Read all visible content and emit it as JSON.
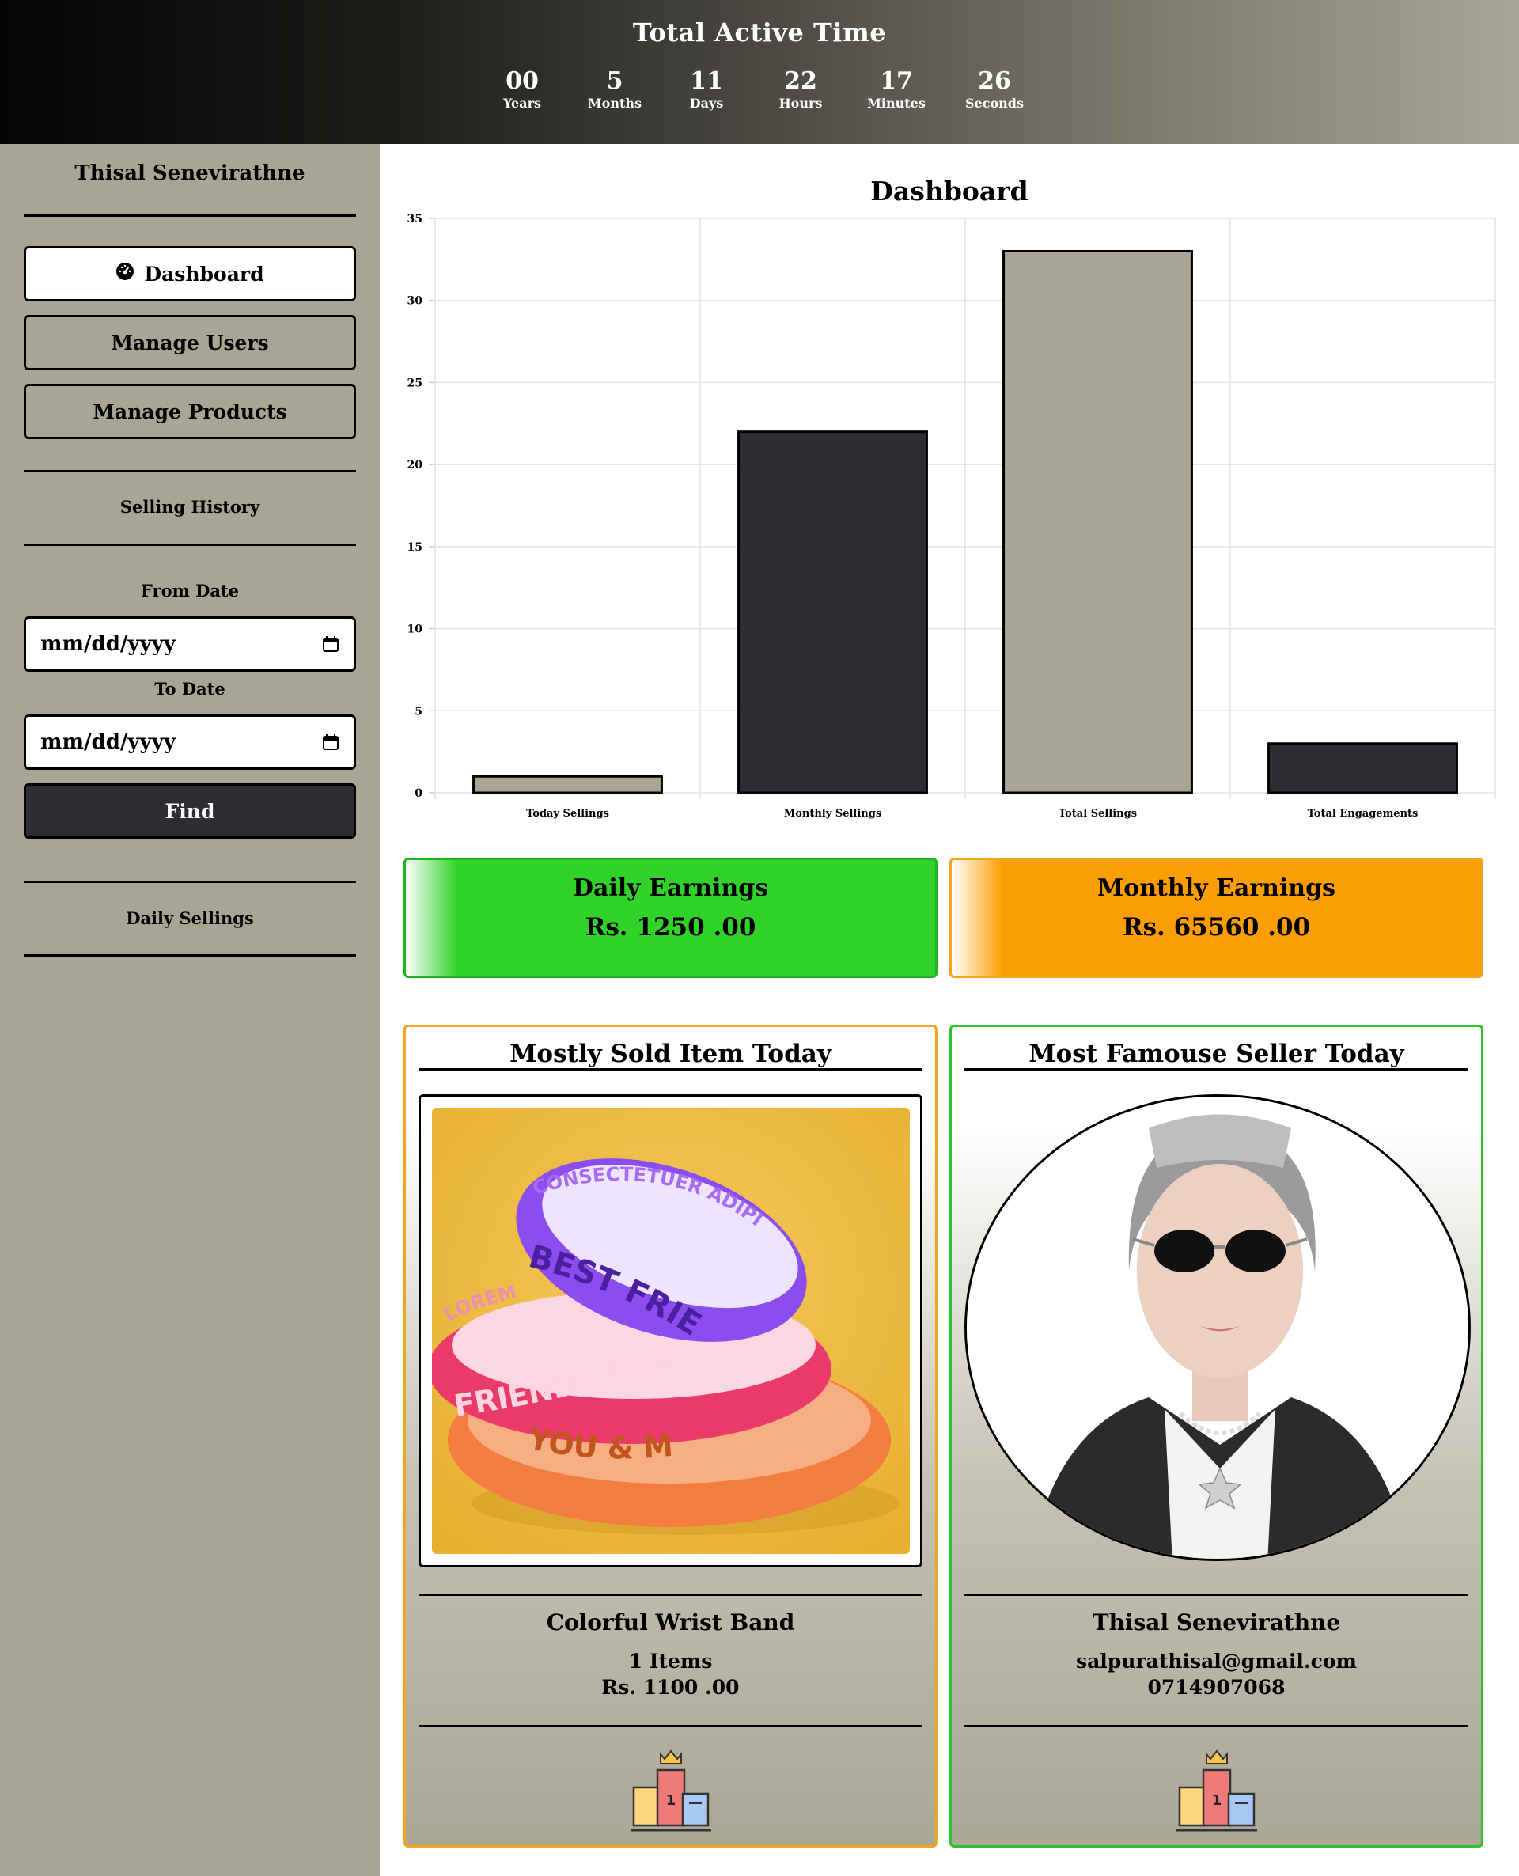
{
  "header": {
    "title": "Total Active Time",
    "timer": [
      {
        "value": "00",
        "label": "Years"
      },
      {
        "value": "5",
        "label": "Months"
      },
      {
        "value": "11",
        "label": "Days"
      },
      {
        "value": "22",
        "label": "Hours"
      },
      {
        "value": "17",
        "label": "Minutes"
      },
      {
        "value": "26",
        "label": "Seconds"
      }
    ]
  },
  "sidebar": {
    "user_name": "Thisal Senevirathne",
    "nav": {
      "dashboard": "Dashboard",
      "manage_users": "Manage Users",
      "manage_products": "Manage Products"
    },
    "selling_history": "Selling History",
    "from_date_label": "From Date",
    "from_date_value": "mm/dd/yyyy",
    "to_date_label": "To Date",
    "to_date_value": "mm/dd/yyyy",
    "find_label": "Find",
    "daily_sellings": "Daily Sellings"
  },
  "main": {
    "chart_title": "Dashboard",
    "daily_earnings": {
      "title": "Daily Earnings",
      "value": "Rs. 1250 .00"
    },
    "monthly_earnings": {
      "title": "Monthly Earnings",
      "value": "Rs. 65560 .00"
    },
    "top_item": {
      "title": "Mostly Sold Item Today",
      "name": "Colorful Wrist Band",
      "count": "1 Items",
      "price": "Rs. 1100 .00",
      "band_texts": [
        "CONSECTETUER ADIPISCING",
        "BEST FRIENDS",
        "LOREM IP",
        "FRIENDS FOREVE",
        "YOU & ME"
      ]
    },
    "top_seller": {
      "title": "Most Famouse Seller Today",
      "name": "Thisal Senevirathne",
      "email": "salpurathisal@gmail.com",
      "phone": "0714907068"
    }
  },
  "colors": {
    "sidebar": "#a9a594",
    "bar_light": "#a9a594",
    "bar_dark": "#2e2d33",
    "green": "#31d32b",
    "orange": "#fb9e05"
  },
  "chart_data": {
    "type": "bar",
    "title": "Dashboard",
    "categories": [
      "Today Sellings",
      "Monthly Sellings",
      "Total Sellings",
      "Total Engagements"
    ],
    "values": [
      1,
      22,
      33,
      3
    ],
    "bar_colors": [
      "#a9a594",
      "#2e2d33",
      "#a9a594",
      "#2e2d33"
    ],
    "ylim": [
      0,
      35
    ],
    "yticks": [
      0,
      5,
      10,
      15,
      20,
      25,
      30,
      35
    ],
    "grid": true,
    "legend": "none",
    "xlabel": "",
    "ylabel": ""
  }
}
